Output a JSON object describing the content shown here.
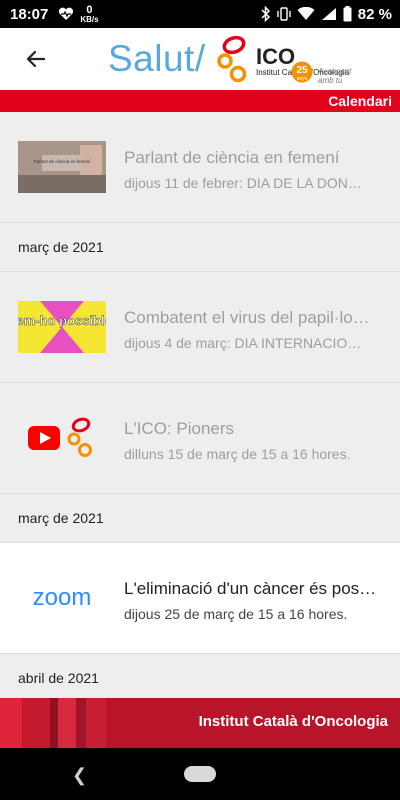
{
  "status": {
    "time": "18:07",
    "speed_value": "0",
    "speed_unit": "KB/s",
    "battery": "82 %"
  },
  "appbar": {
    "brand_salut": "Salut/",
    "brand_ico": "ICO",
    "brand_ico_sub": "Institut Català d'Oncologia",
    "badge": "25 anys",
    "tagline_line1": "Avançant",
    "tagline_line2": "amb tu"
  },
  "section_label": "Calendari",
  "items": [
    {
      "title": "Parlant de ciència en femení",
      "subtitle": "dijous 11 de febrer: DIA DE LA DON…",
      "thumb_text": "Parlant de ciència en femení"
    },
    {
      "header": "març de 2021"
    },
    {
      "title": "Combatent el virus del papil·lo…",
      "subtitle": "dijous 4 de març: DIA INTERNACIO…",
      "thumb_text": "fem-ho possible"
    },
    {
      "title": "L'ICO: Pioners",
      "subtitle": "dilluns 15 de març de 15 a 16 hores."
    },
    {
      "header": "març de 2021"
    },
    {
      "title": "L'eliminació d'un càncer és pos…",
      "subtitle": "dijous 25 de març de 15 a 16 hores.",
      "thumb_text": "zoom"
    },
    {
      "header": "abril de 2021"
    }
  ],
  "footer": {
    "text": "Institut Català d'Oncologia"
  },
  "colors": {
    "accent_red": "#e2001a",
    "brand_blue": "#5aa8dc",
    "ico_orange": "#f39200"
  }
}
